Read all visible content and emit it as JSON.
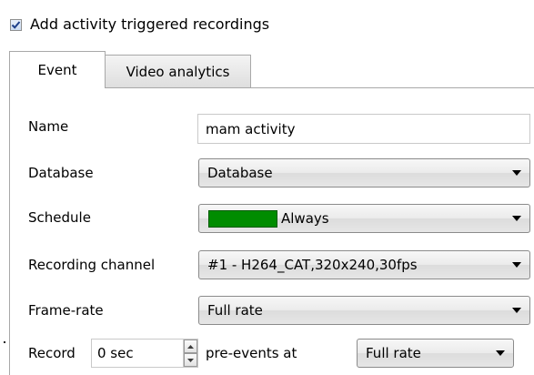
{
  "header": {
    "checkbox_checked": true,
    "label": "Add activity triggered recordings"
  },
  "tabs": [
    {
      "label": "Event",
      "active": true
    },
    {
      "label": "Video analytics",
      "active": false
    }
  ],
  "form": {
    "name": {
      "label": "Name",
      "value": "mam activity"
    },
    "database": {
      "label": "Database",
      "value": "Database"
    },
    "schedule": {
      "label": "Schedule",
      "value": "Always",
      "swatch_color": "#008c00"
    },
    "recording_channel": {
      "label": "Recording channel",
      "value": "#1 - H264_CAT,320x240,30fps"
    },
    "frame_rate": {
      "label": "Frame-rate",
      "value": "Full rate"
    },
    "record": {
      "label": "Record",
      "pre_time_value": "0 sec",
      "pre_events_label": "pre-events at",
      "pre_rate_value": "Full rate"
    }
  },
  "icons": {
    "dropdown": "chevron-down-icon",
    "spin_up": "arrow-up-icon",
    "spin_down": "arrow-down-icon",
    "checkbox": "checkmark-icon"
  }
}
